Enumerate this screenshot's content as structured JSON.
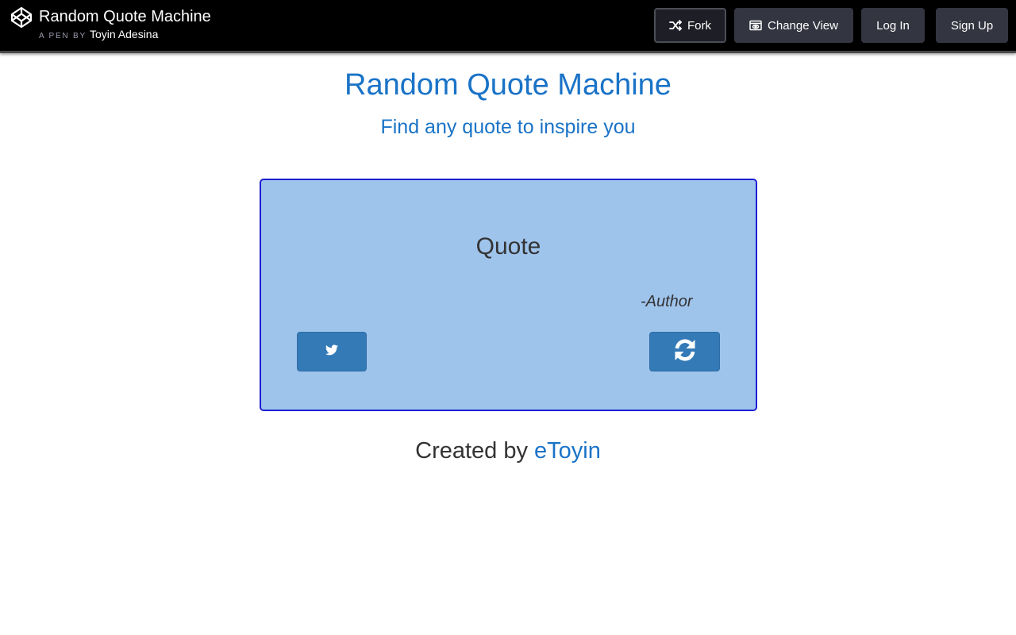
{
  "header": {
    "logo_icon": "codepen-icon",
    "pen_title": "Random Quote Machine",
    "byline_prefix": "A PEN BY",
    "author": "Toyin Adesina",
    "buttons": {
      "fork": {
        "label": "Fork",
        "icon": "fork-icon"
      },
      "change_view": {
        "label": "Change View",
        "icon": "change-view-icon"
      },
      "login": {
        "label": "Log In"
      },
      "signup": {
        "label": "Sign Up"
      }
    }
  },
  "main": {
    "title": "Random Quote Machine",
    "subtitle": "Find any quote to inspire you",
    "quote_box": {
      "quote": "Quote",
      "author": "-Author",
      "tweet_button_icon": "twitter-icon",
      "new_quote_button_icon": "refresh-icon"
    },
    "footer": {
      "prefix": "Created by",
      "link": "eToyin"
    }
  },
  "colors": {
    "topbar_bg": "#000000",
    "topbar_button": "#333540",
    "accent_blue": "#1a73c7",
    "quote_box_bg": "#9fc4ec",
    "quote_box_border": "#1d1fd1",
    "button_blue": "#337ab7"
  }
}
